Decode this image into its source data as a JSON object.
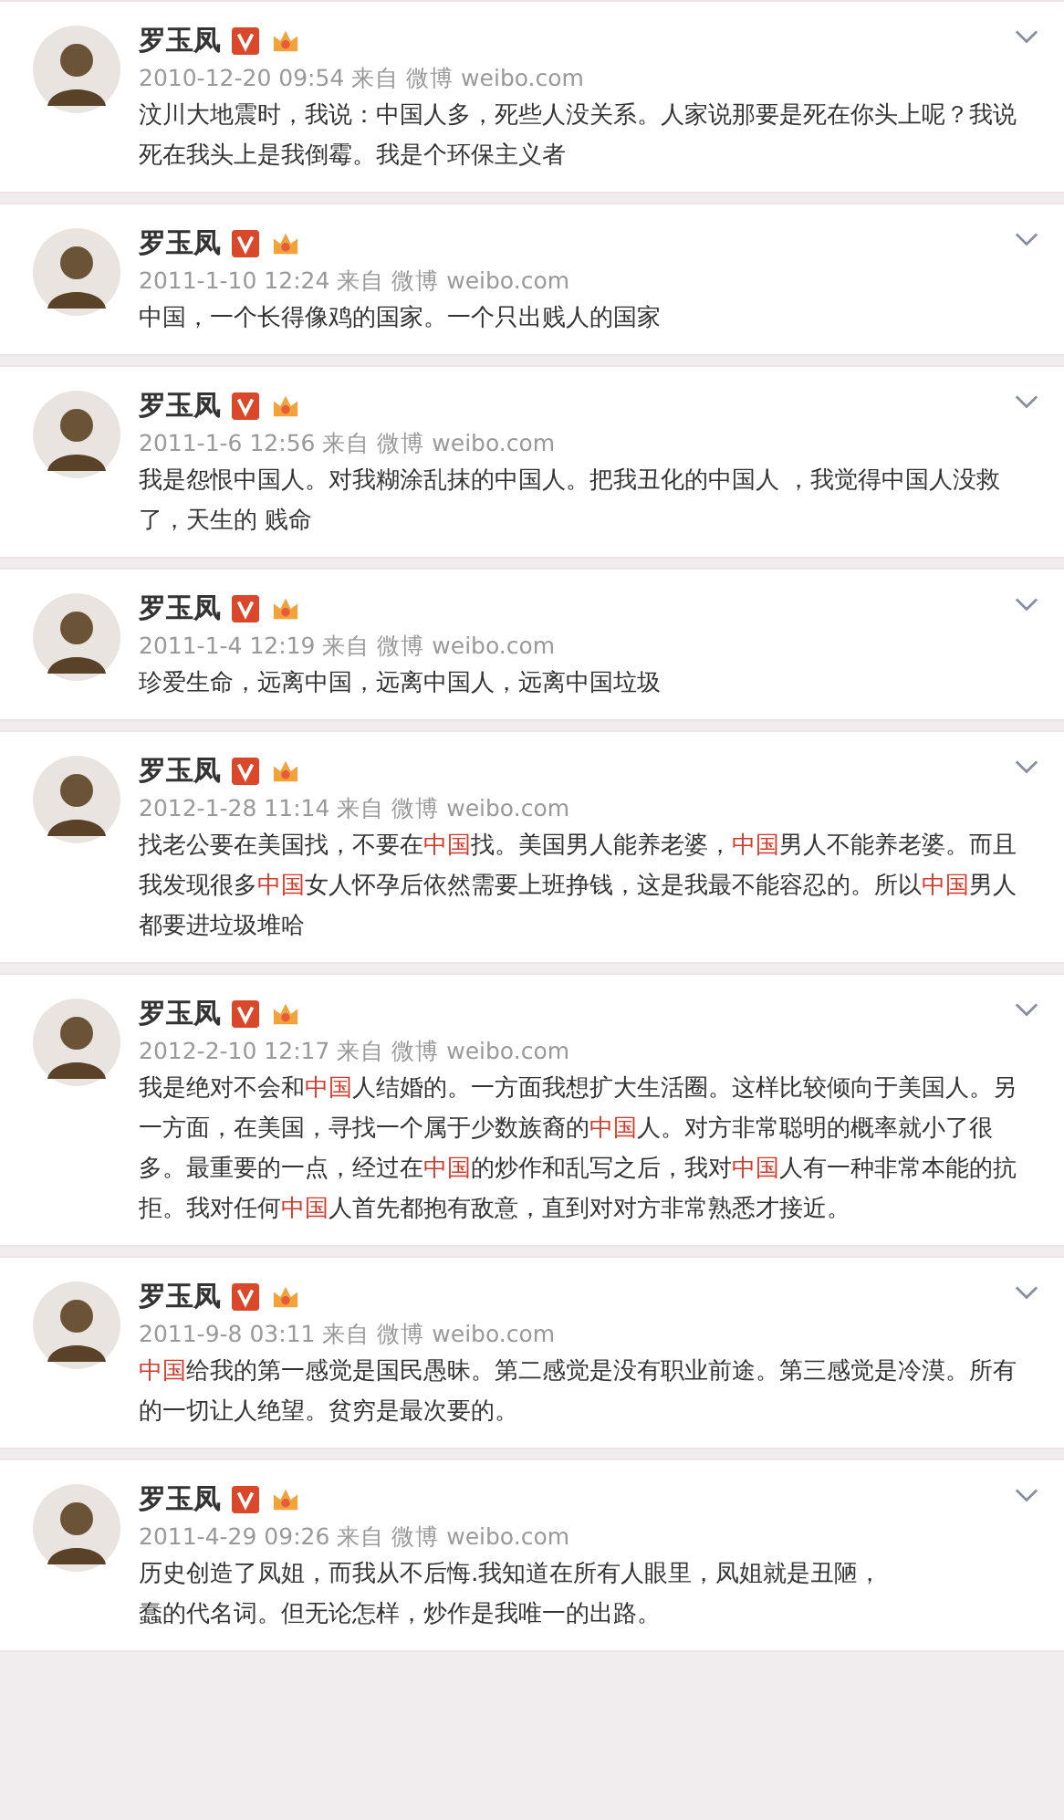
{
  "posts": [
    {
      "author": "罗玉凤",
      "meta": "2010-12-20 09:54 来自 微博 weibo.com",
      "body": [
        [
          {
            "text": "汶川大地震时，我说：中国人多，死些人没关系。人家说那要是死在你头上呢？我说死在我头上是我倒霉。我是个环保主义者",
            "highlight": false
          }
        ]
      ]
    },
    {
      "author": "罗玉凤",
      "meta": "2011-1-10 12:24 来自 微博 weibo.com",
      "body": [
        [
          {
            "text": "中国，一个长得像鸡的国家。一个只出贱人的国家",
            "highlight": false
          }
        ]
      ]
    },
    {
      "author": "罗玉凤",
      "meta": "2011-1-6 12:56 来自 微博 weibo.com",
      "body": [
        [
          {
            "text": "我是怨恨中国人。对我糊涂乱抹的中国人。把我丑化的中国人 ，我觉得中国人没救了，天生的 贱命",
            "highlight": false
          }
        ]
      ]
    },
    {
      "author": "罗玉凤",
      "meta": "2011-1-4 12:19 来自 微博 weibo.com",
      "body": [
        [
          {
            "text": "珍爱生命，远离中国，远离中国人，远离中国垃圾",
            "highlight": false
          }
        ]
      ]
    },
    {
      "author": "罗玉凤",
      "meta": "2012-1-28 11:14 来自 微博 weibo.com",
      "body": [
        [
          {
            "text": "找老公要在美国找，不要在",
            "highlight": false
          },
          {
            "text": "中国",
            "highlight": true
          },
          {
            "text": "找。美国男人能养老婆，",
            "highlight": false
          },
          {
            "text": "中国",
            "highlight": true
          },
          {
            "text": "男人不能养老婆。而且我发现很多",
            "highlight": false
          },
          {
            "text": "中国",
            "highlight": true
          },
          {
            "text": "女人怀孕后依然需要上班挣钱，这是我最不能容忍的。所以",
            "highlight": false
          },
          {
            "text": "中国",
            "highlight": true
          },
          {
            "text": "男人都要进垃圾堆哈",
            "highlight": false
          }
        ]
      ]
    },
    {
      "author": "罗玉凤",
      "meta": "2012-2-10 12:17 来自 微博 weibo.com",
      "body": [
        [
          {
            "text": "我是绝对不会和",
            "highlight": false
          },
          {
            "text": "中国",
            "highlight": true
          },
          {
            "text": "人结婚的。一方面我想扩大生活圈。这样比较倾向于美国人。另一方面，在美国，寻找一个属于少数族裔的",
            "highlight": false
          },
          {
            "text": "中国",
            "highlight": true
          },
          {
            "text": "人。对方非常聪明的概率就小了很多。最重要的一点，经过在",
            "highlight": false
          },
          {
            "text": "中国",
            "highlight": true
          },
          {
            "text": "的炒作和乱写之后，我对",
            "highlight": false
          },
          {
            "text": "中国",
            "highlight": true
          },
          {
            "text": "人有一种非常本能的抗拒。我对任何",
            "highlight": false
          },
          {
            "text": "中国",
            "highlight": true
          },
          {
            "text": "人首先都抱有敌意，直到对对方非常熟悉才接近。",
            "highlight": false
          }
        ]
      ]
    },
    {
      "author": "罗玉凤",
      "meta": "2011-9-8 03:11 来自 微博 weibo.com",
      "body": [
        [
          {
            "text": "中国",
            "highlight": true
          },
          {
            "text": "给我的第一感觉是国民愚昧。第二感觉是没有职业前途。第三感觉是冷漠。所有的一切让人绝望。贫穷是最次要的。",
            "highlight": false
          }
        ]
      ]
    },
    {
      "author": "罗玉凤",
      "meta": "2011-4-29 09:26 来自 微博 weibo.com",
      "body": [
        [
          {
            "text": "历史创造了凤姐，而我从不后悔.我知道在所有人眼里，凤姐就是丑陋，",
            "highlight": false
          }
        ],
        [
          {
            "text": "蠢的代名词。但无论怎样，炒作是我唯一的出路。",
            "highlight": false
          }
        ]
      ]
    }
  ]
}
